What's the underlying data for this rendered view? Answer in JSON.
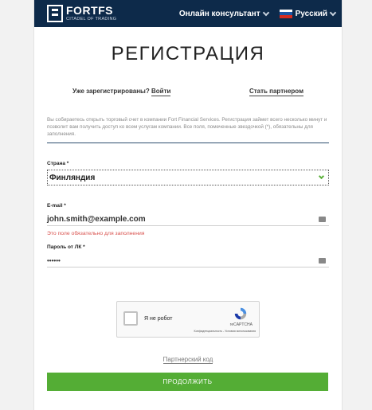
{
  "header": {
    "logo_name": "FORTFS",
    "logo_tagline": "CITADEL OF TRADING",
    "consultant_label": "Онлайн консультант",
    "language_label": "Русский"
  },
  "page_title": "РЕГИСТРАЦИЯ",
  "links": {
    "already_registered_prefix": "Уже зарегистрированы?",
    "login": "Войти",
    "become_partner": "Стать партнером"
  },
  "description": "Вы собираетесь открыть торговый счет в компании Fort Financial Services. Регистрация займет всего несколько минут и позволит вам получить доступ ко всем услугам компании. Все поля, помеченные звездочкой (*), обязательны для заполнения.",
  "form": {
    "country_label": "Страна *",
    "country_value": "Финляндия",
    "email_label": "E-mail *",
    "email_value": "john.smith@example.com",
    "email_error": "Это поле обязательно для заполнения",
    "password_label": "Пароль от ЛК *",
    "password_value": "••••••"
  },
  "captcha": {
    "label": "Я не робот",
    "brand": "reCAPTCHA",
    "links": "Конфиденциальность - Условия использования"
  },
  "partner_code": "Партнерский код",
  "submit_label": "ПРОДОЛЖИТЬ",
  "colors": {
    "header_bg": "#0d2a4a",
    "accent_green": "#54ad35",
    "error_red": "#d9534f"
  }
}
